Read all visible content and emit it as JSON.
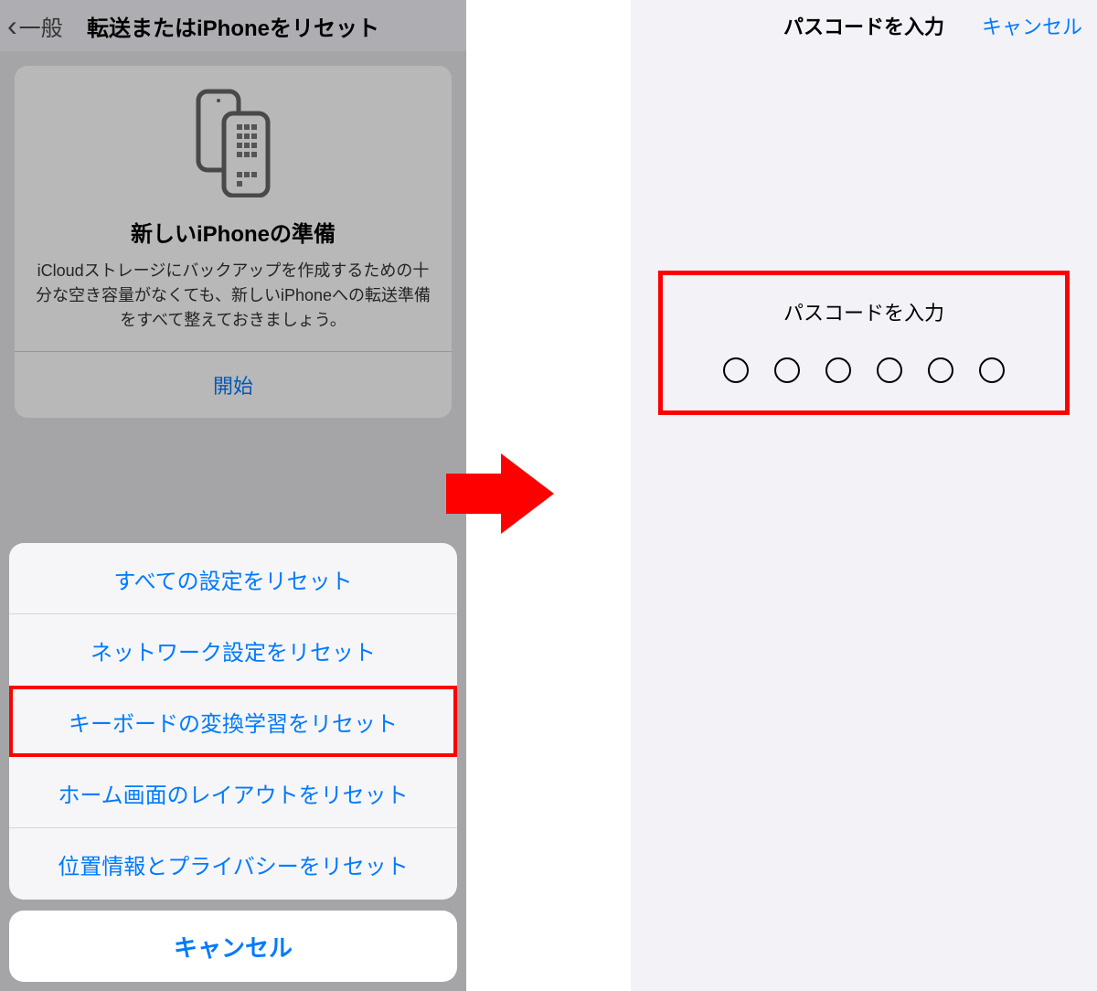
{
  "left": {
    "nav": {
      "back_label": "一般",
      "title": "転送またはiPhoneをリセット"
    },
    "card": {
      "title": "新しいiPhoneの準備",
      "description": "iCloudストレージにバックアップを作成するための十分な空き容量がなくても、新しいiPhoneへの転送準備をすべて整えておきましょう。",
      "start_label": "開始"
    },
    "sheet": {
      "options": [
        "すべての設定をリセット",
        "ネットワーク設定をリセット",
        "キーボードの変換学習をリセット",
        "ホーム画面のレイアウトをリセット",
        "位置情報とプライバシーをリセット"
      ],
      "cancel_label": "キャンセル",
      "highlighted_index": 2
    }
  },
  "right": {
    "nav": {
      "title": "パスコードを入力",
      "cancel_label": "キャンセル"
    },
    "passcode": {
      "prompt": "パスコードを入力",
      "length": 6
    }
  },
  "colors": {
    "accent": "#007aff",
    "highlight": "#ff0000",
    "arrow": "#ff0000"
  }
}
